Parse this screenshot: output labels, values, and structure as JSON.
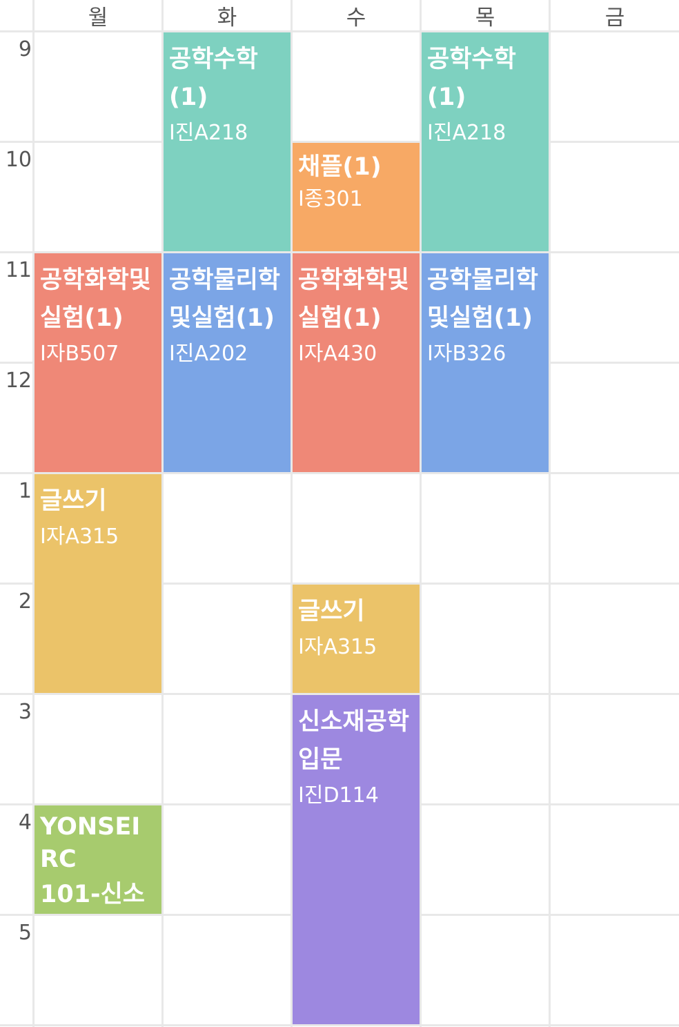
{
  "days": [
    "월",
    "화",
    "수",
    "목",
    "금"
  ],
  "hours": [
    "9",
    "10",
    "11",
    "12",
    "1",
    "2",
    "3",
    "4",
    "5"
  ],
  "colors": {
    "teal": "#7ED1C0",
    "orange": "#F7A965",
    "salmon": "#EF8877",
    "blue": "#7BA5E6",
    "yellow": "#EBC369",
    "purple": "#9D88E0",
    "green": "#A7CB6E"
  },
  "courses": [
    {
      "title": "공학수학(1)",
      "room": "I진A218",
      "day": "화",
      "start": "9",
      "end": "11",
      "color": "teal"
    },
    {
      "title": "공학수학(1)",
      "room": "I진A218",
      "day": "목",
      "start": "9",
      "end": "11",
      "color": "teal"
    },
    {
      "title": "채플(1)",
      "room": "I종301",
      "day": "수",
      "start": "10",
      "end": "11",
      "color": "orange"
    },
    {
      "title": "공학화학및실험(1)",
      "room": "I자B507",
      "day": "월",
      "start": "11",
      "end": "1",
      "color": "salmon"
    },
    {
      "title": "공학물리학및실험(1)",
      "room": "I진A202",
      "day": "화",
      "start": "11",
      "end": "1",
      "color": "blue"
    },
    {
      "title": "공학화학및실험(1)",
      "room": "I자A430",
      "day": "수",
      "start": "11",
      "end": "1",
      "color": "salmon"
    },
    {
      "title": "공학물리학및실험(1)",
      "room": "I자B326",
      "day": "목",
      "start": "11",
      "end": "1",
      "color": "blue"
    },
    {
      "title": "글쓰기",
      "room": "I자A315",
      "day": "월",
      "start": "1",
      "end": "3",
      "color": "yellow"
    },
    {
      "title": "글쓰기",
      "room": "I자A315",
      "day": "수",
      "start": "2",
      "end": "3",
      "color": "yellow"
    },
    {
      "title": "신소재공학입문",
      "room": "I진D114",
      "day": "수",
      "start": "3",
      "end": "6",
      "color": "purple"
    },
    {
      "title": "YONSEI RC",
      "subtitle": "101-신소",
      "day": "월",
      "start": "4",
      "end": "5",
      "color": "green"
    }
  ]
}
